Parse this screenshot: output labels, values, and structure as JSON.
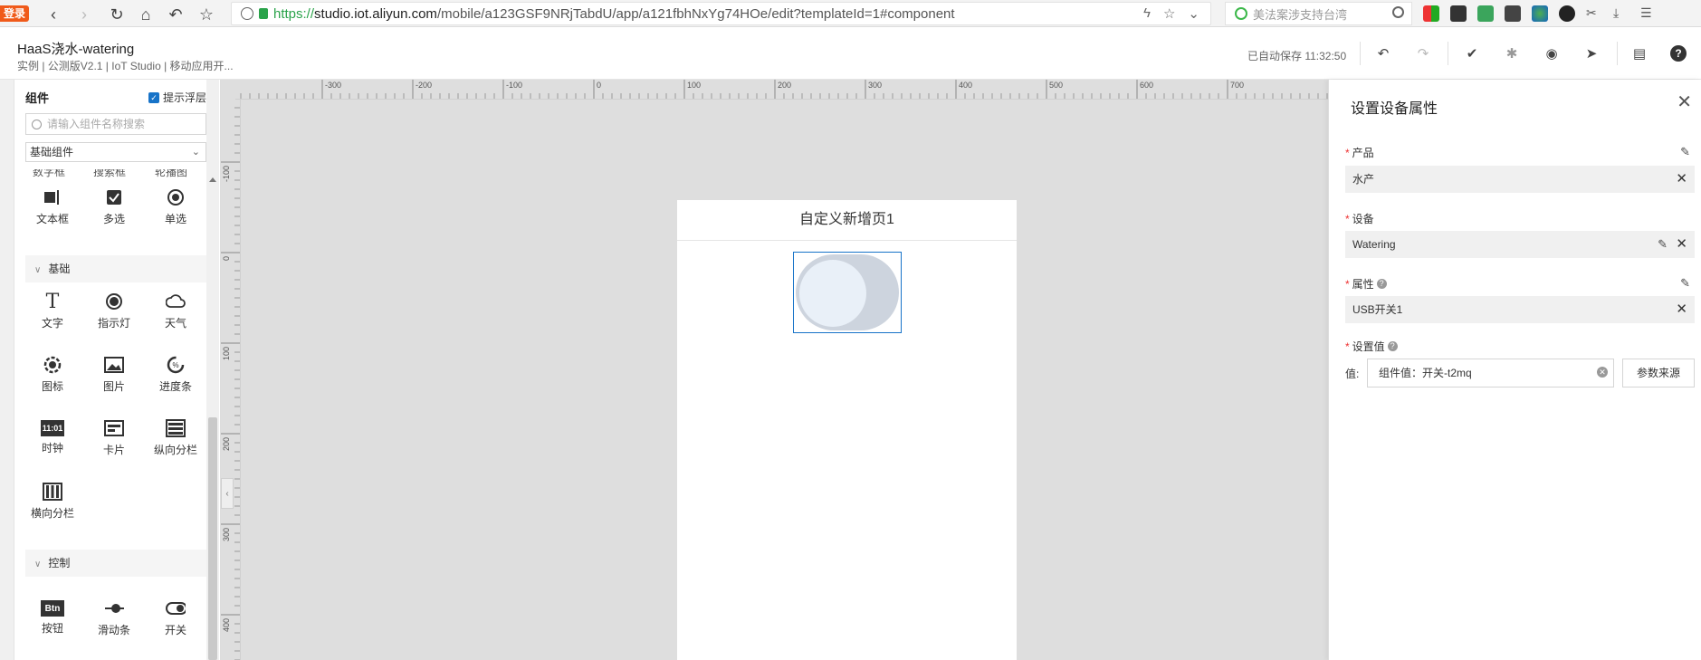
{
  "browser": {
    "login_badge": "登录",
    "url_scheme": "https://",
    "url_host": "studio.iot.aliyun.com",
    "url_path": "/mobile/a123GSF9NRjTabdU/app/a121fbhNxYg74HOe/edit?templateId=1#component",
    "search_placeholder": "美法案涉支持台湾"
  },
  "header": {
    "title": "HaaS浇水-watering",
    "subtitle": "实例 | 公测版V2.1 | IoT Studio | 移动应用开...",
    "autosave": "已自动保存 11:32:50"
  },
  "sidebar": {
    "title": "组件",
    "hint_layer": "提示浮层",
    "search_placeholder": "请输入组件名称搜索",
    "category": "基础组件",
    "cut_labels": [
      "数字框",
      "搜索框",
      "轮播图"
    ],
    "form_items": [
      "文本框",
      "多选",
      "单选"
    ],
    "basic_section": "基础",
    "basic_items": [
      "文字",
      "指示灯",
      "天气",
      "图标",
      "图片",
      "进度条",
      "时钟",
      "卡片",
      "纵向分栏",
      "横向分栏"
    ],
    "clock_icon_text": "11:01",
    "control_section": "控制",
    "control_items": [
      "按钮",
      "滑动条",
      "开关"
    ],
    "button_icon_text": "Btn"
  },
  "canvas": {
    "ruler_top": [
      "-300",
      "-200",
      "-100",
      "0",
      "100",
      "200",
      "300",
      "400",
      "500",
      "600",
      "700"
    ],
    "ruler_left": [
      "-100",
      "0",
      "100",
      "200",
      "300",
      "400"
    ],
    "page_title": "自定义新增页1"
  },
  "panel": {
    "title": "设置设备属性",
    "product_label": "产品",
    "product_value": "水产",
    "device_label": "设备",
    "device_value": "Watering",
    "property_label": "属性",
    "property_value": "USB开关1",
    "set_value_label": "设置值",
    "value_prefix": "值:",
    "value_text": "组件值：开关-t2mq",
    "source_button": "参数来源"
  }
}
